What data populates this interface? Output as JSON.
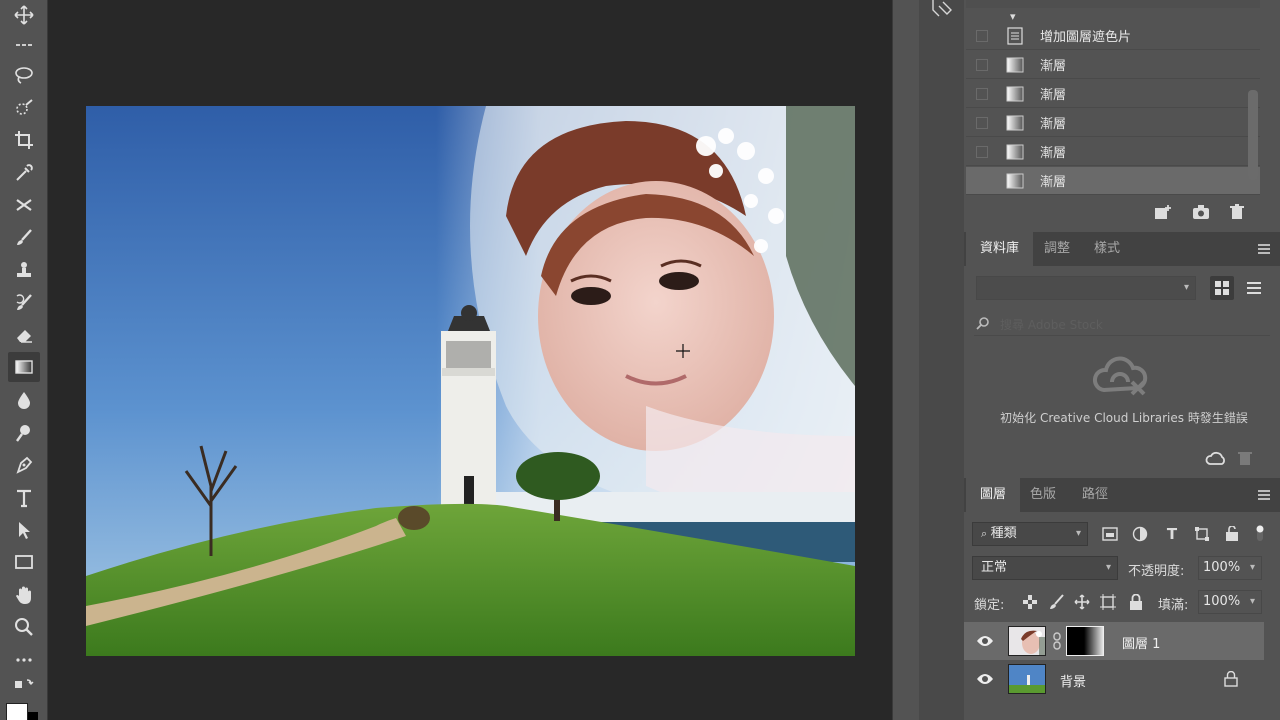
{
  "history": {
    "items": [
      {
        "label": "增加圖層遮色片",
        "icon": "layer-mask-history-icon"
      },
      {
        "label": "漸層",
        "icon": "gradient-history-icon"
      },
      {
        "label": "漸層",
        "icon": "gradient-history-icon"
      },
      {
        "label": "漸層",
        "icon": "gradient-history-icon"
      },
      {
        "label": "漸層",
        "icon": "gradient-history-icon"
      },
      {
        "label": "漸層",
        "icon": "gradient-history-icon",
        "selected": true
      }
    ]
  },
  "library_tabs": [
    "資料庫",
    "調整",
    "樣式"
  ],
  "libraries": {
    "search_placeholder": "搜尋 Adobe Stock",
    "error_message": "初始化 Creative Cloud Libraries 時發生錯誤"
  },
  "layers_tabs": [
    "圖層",
    "色版",
    "路徑"
  ],
  "layers": {
    "filter_kind": "種類",
    "blend_mode": "正常",
    "opacity_label": "不透明度:",
    "opacity_value": "100%",
    "lock_label": "鎖定:",
    "fill_label": "填滿:",
    "fill_value": "100%",
    "list": [
      {
        "name": "圖層 1",
        "selected": true,
        "has_mask": true
      },
      {
        "name": "背景",
        "selected": false,
        "locked": true
      }
    ]
  },
  "colors": {
    "panel_bg": "#535353",
    "workspace_bg": "#282828",
    "selected_row": "#6a6a6a"
  }
}
